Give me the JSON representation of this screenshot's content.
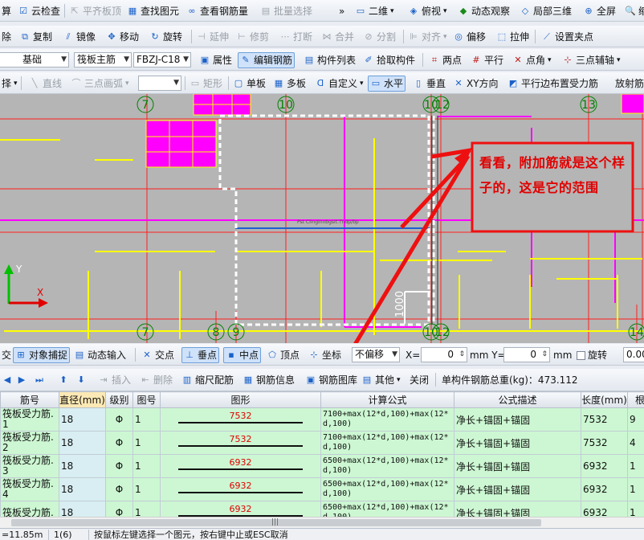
{
  "toolbar1": {
    "items": [
      "算",
      "云检查",
      "平齐板顶",
      "查找图元",
      "查看钢筋量",
      "批量选择",
      "二维",
      "俯视",
      "动态观察",
      "局部三维",
      "全屏",
      "缩"
    ],
    "more": "»"
  },
  "toolbar2": {
    "items": [
      "除",
      "复制",
      "镜像",
      "移动",
      "旋转",
      "延伸",
      "修剪",
      "打断",
      "合并",
      "分割",
      "对齐",
      "偏移",
      "拉伸",
      "设置夹点"
    ]
  },
  "toolbar3": {
    "combo_floor": "基础",
    "combo_type": "筏板主筋",
    "combo_name": "FBZJ-C18",
    "items": [
      "属性",
      "编辑钢筋",
      "构件列表",
      "拾取构件",
      "两点",
      "平行",
      "点角",
      "三点辅轴"
    ]
  },
  "toolbar4": {
    "first": "择",
    "line": "直线",
    "arc": "三点画弧",
    "combo_blank": "",
    "items": [
      "矩形",
      "单板",
      "多板",
      "自定义",
      "水平",
      "垂直",
      "XY方向",
      "平行边布置受力筋",
      "放射筋"
    ]
  },
  "canvas": {
    "axis_top": [
      "7",
      "10",
      "10",
      "12",
      "13"
    ],
    "axis_bottom": [
      "7",
      "8",
      "9",
      "10",
      "12",
      "14"
    ],
    "dim_label": "1000",
    "tiny_text": "Pst Clinginnbgsit.Tndp/bp",
    "axis_y_label": "Y",
    "axis_x_label": "X",
    "annotation": "看看，附加筋就是这个样子的，这是它的范围"
  },
  "snap_bar": {
    "items": [
      "交",
      "对象捕捉",
      "动态输入",
      "交点",
      "垂点",
      "中点",
      "顶点",
      "坐标"
    ],
    "offset_combo": "不偏移",
    "x_label": "X=",
    "x_value": "0",
    "y_label": "mm Y=",
    "y_value": "0",
    "mm": "mm",
    "rotate_label": "旋转",
    "rotate_value": "0.00"
  },
  "grid_toolbar": {
    "items": [
      "插入",
      "删除",
      "缩尺配筋",
      "钢筋信息",
      "钢筋图库",
      "其他",
      "关闭"
    ],
    "total": "单构件钢筋总重(kg)：473.112"
  },
  "table": {
    "columns": [
      "筋号",
      "直径(mm)",
      "级别",
      "图号",
      "图形",
      "计算公式",
      "公式描述",
      "长度(mm)",
      "根"
    ],
    "rows": [
      {
        "name": "筏板受力筋.1",
        "dia": "18",
        "grade": "Φ",
        "fig": "1",
        "shape": "7532",
        "formula": "7100+max(12*d,100)+max(12*d,100)",
        "desc": "净长+锚固+锚固",
        "length": "7532",
        "count": "9"
      },
      {
        "name": "筏板受力筋.2",
        "dia": "18",
        "grade": "Φ",
        "fig": "1",
        "shape": "7532",
        "formula": "7100+max(12*d,100)+max(12*d,100)",
        "desc": "净长+锚固+锚固",
        "length": "7532",
        "count": "4"
      },
      {
        "name": "筏板受力筋.3",
        "dia": "18",
        "grade": "Φ",
        "fig": "1",
        "shape": "6932",
        "formula": "6500+max(12*d,100)+max(12*d,100)",
        "desc": "净长+锚固+锚固",
        "length": "6932",
        "count": "1"
      },
      {
        "name": "筏板受力筋.4",
        "dia": "18",
        "grade": "Φ",
        "fig": "1",
        "shape": "6932",
        "formula": "6500+max(12*d,100)+max(12*d,100)",
        "desc": "净长+锚固+锚固",
        "length": "6932",
        "count": "1"
      },
      {
        "name": "筏板受力筋.",
        "dia": "18",
        "grade": "Φ",
        "fig": "1",
        "shape": "6932",
        "formula": "6500+max(12*d,100)+max(12*d,100)",
        "desc": "净长+锚固+锚固",
        "length": "6932",
        "count": "1"
      }
    ]
  },
  "bottom": {
    "coord": "=11.85m",
    "page": "1(6)",
    "hint": "按鼠标左键选择一个图元，按右键中止或ESC取消"
  },
  "colors": {
    "canvas_bg": "#b5b5b5",
    "magenta": "#ff00ff",
    "red": "#ff2020",
    "yellow": "#ffff00",
    "green": "#00a000",
    "blue": "#1f5fd0",
    "row_bg": "#ccf7d2",
    "annotation_text": "#e00000"
  }
}
